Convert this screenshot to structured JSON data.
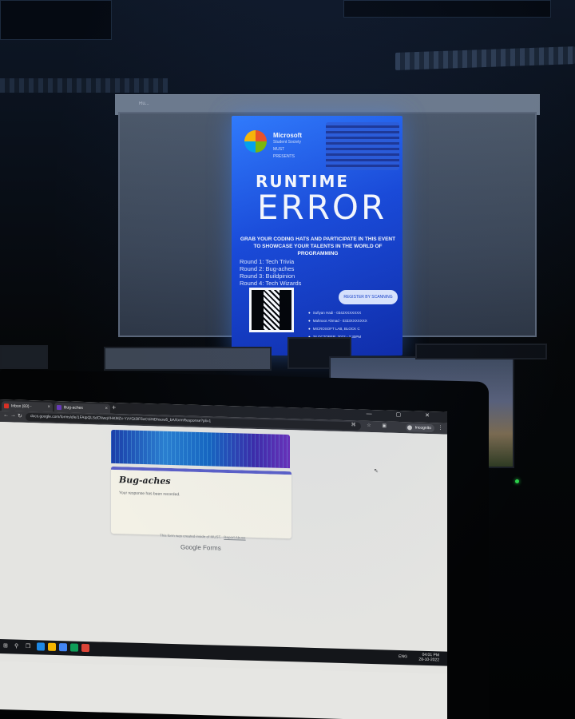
{
  "projection": {
    "topbar_text": "Ru...",
    "poster": {
      "brand_line1": "Microsoft",
      "brand_line2": "Student Society",
      "brand_line3": "MUST",
      "presents": "PRESENTS",
      "title_line1": "RUNTIME",
      "title_line2": "ERROR",
      "tagline": "GRAB YOUR CODING HATS AND PARTICIPATE IN THIS EVENT TO SHOWCASE YOUR TALENTS IN THE WORLD OF PROGRAMMING",
      "rounds": [
        "Round 1: Tech Trivia",
        "Round 2: Bug-aches",
        "Round 3: Buildpinion",
        "Round 4: Tech Wizards"
      ],
      "register_button": "REGISTER BY SCANNING",
      "contacts": [
        "Sufiyan Hadi - 0342XXXXXXX",
        "Mahnoor Ahmad - 0333XXXXXXX",
        "MICROSOFT LAB, BLOCK C",
        "28 OCTOBER, 2022 - 2:30PM"
      ]
    }
  },
  "browser": {
    "tabs": [
      {
        "label": "Inbox (83) - 1654217263..."
      },
      {
        "label": "Bug-aches"
      }
    ],
    "new_tab_label": "+",
    "window_controls": "— ▢ ✕",
    "url": "docs.google.com/forms/d/e/1FAIpQLSdCNwqVHKMZx-YzVGt3iF6oCUiNDhsow5_bA/formResponse?pli=1",
    "incognito_label": "Incognito",
    "toolbar_icons": "⌘ ☆ ▣"
  },
  "form": {
    "title": "Bug-aches",
    "confirmation": "Your response has been recorded.",
    "footer_text": "This form was created inside of MUST.",
    "footer_link": "Report Abuse",
    "brand_google": "Google",
    "brand_forms": "Forms"
  },
  "taskbar": {
    "language": "ENG",
    "time": "04:01 PM",
    "date": "28-10-2022"
  },
  "colors": {
    "poster_blue": "#1748d9",
    "form_accent": "#5b5fc7",
    "led_green": "#2bd04a"
  }
}
